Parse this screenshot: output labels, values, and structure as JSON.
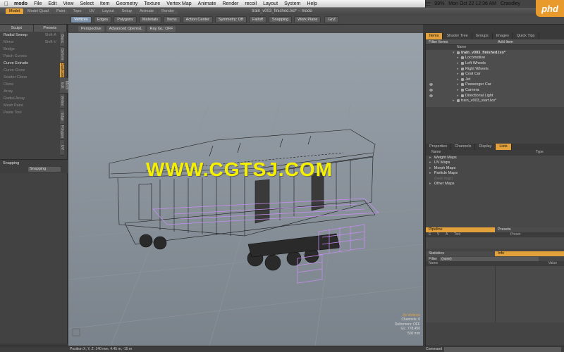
{
  "macmenu": {
    "apple": "",
    "items": [
      "modo",
      "File",
      "Edit",
      "View",
      "Select",
      "Item",
      "Geometry",
      "Texture",
      "Vertex Map",
      "Animate",
      "Render",
      "recoil",
      "Layout",
      "System",
      "Help"
    ],
    "battery": "99%",
    "clock": "Mon Oct 22  12:36 AM",
    "user": "Crandley"
  },
  "logo": "phd",
  "window": {
    "title": "train_v003_finished.lxo* – modo",
    "tabs": [
      "Model",
      "Model Quad",
      "Paint",
      "Topo",
      "UV",
      "Layout",
      "Setup",
      "Animate",
      "Render"
    ],
    "active_tab": "Model"
  },
  "toolbar": {
    "modes": [
      "Vertices",
      "Edges",
      "Polygons",
      "Materials",
      "Items"
    ],
    "active_mode": "Vertices",
    "action_center": "Action Center",
    "symmetry": "Symmetry: Off",
    "falloff": "Falloff",
    "snapping": "Snapping",
    "work_plane": "Work Plane",
    "gnz": "GnZ"
  },
  "left": {
    "header": [
      "Sculpt",
      "Presets"
    ],
    "tools": [
      {
        "label": "Radial Sweep",
        "shortcut": "Shift-A",
        "dim": false
      },
      {
        "label": "Mirror",
        "shortcut": "Shift-V",
        "dim": true
      },
      {
        "label": "Bridge",
        "shortcut": "",
        "dim": true
      },
      {
        "label": "Patch Curves",
        "shortcut": "",
        "dim": true
      },
      {
        "label": "Curve Extrude",
        "shortcut": "",
        "dim": false
      },
      {
        "label": "Curve Clone",
        "shortcut": "",
        "dim": true
      },
      {
        "label": "Scatter Clone",
        "shortcut": "",
        "dim": true
      },
      {
        "label": "Clone",
        "shortcut": "",
        "dim": true
      },
      {
        "label": "Array",
        "shortcut": "",
        "dim": true
      },
      {
        "label": "Radial Array",
        "shortcut": "",
        "dim": true
      },
      {
        "label": "Mesh Paint",
        "shortcut": "",
        "dim": true
      },
      {
        "label": "Paste Tool",
        "shortcut": "",
        "dim": true
      }
    ],
    "vtabs": [
      "Basic",
      "Deform",
      "Duplicate",
      "Mesh Edit",
      "Vertex",
      "Edge",
      "Polygon",
      "UV"
    ],
    "active_vtab": "Duplicate",
    "snapping_header": "Snapping",
    "snapping_label": "Snapping"
  },
  "viewport": {
    "header": [
      "Perspective",
      "Advanced OpenGL",
      "Ray GL: OFF"
    ],
    "watermark": "WWW.CGTSJ.COM",
    "stats": [
      "2p Vertices",
      "Channels: 0",
      "Deformers: OFF",
      "GL: 778,450",
      "500 mm"
    ]
  },
  "status": {
    "position": "Position X, Y, Z:   140 mm, 4.45 m, -15 m",
    "command": "Command"
  },
  "items_panel": {
    "tabs": [
      "Items",
      "Shader Tree",
      "Groups",
      "Images",
      "Quick Tips"
    ],
    "active_tab": "Items",
    "filter": "Filter Items",
    "add": "Add Item",
    "column": "Name",
    "tree": [
      {
        "label": "train_v003_finished.lxo*",
        "depth": 0,
        "eye": false,
        "expanded": true
      },
      {
        "label": "Locomotive",
        "depth": 1,
        "eye": false
      },
      {
        "label": "Left Wheels",
        "depth": 1,
        "eye": false
      },
      {
        "label": "Right Wheels",
        "depth": 1,
        "eye": false
      },
      {
        "label": "Coal Car",
        "depth": 1,
        "eye": false
      },
      {
        "label": "Jet",
        "depth": 1,
        "eye": false
      },
      {
        "label": "Passenger Car",
        "depth": 1,
        "eye": true
      },
      {
        "label": "Camera",
        "depth": 1,
        "eye": true
      },
      {
        "label": "Directional Light",
        "depth": 1,
        "eye": true
      },
      {
        "label": "train_v003_start.lxo*",
        "depth": 0,
        "eye": false
      }
    ]
  },
  "lists_panel": {
    "tabs": [
      "Properties",
      "Channels",
      "Display",
      "Lists"
    ],
    "active_tab": "Lists",
    "col_name": "Name",
    "col_type": "Type",
    "items": [
      {
        "label": "Weight Maps",
        "dim": false,
        "arrow": true
      },
      {
        "label": "UV Maps",
        "dim": false,
        "arrow": true
      },
      {
        "label": "Morph Maps",
        "dim": false,
        "arrow": true
      },
      {
        "label": "Particle Maps",
        "dim": false,
        "arrow": true
      },
      {
        "label": "(new map)",
        "dim": true,
        "arrow": false
      },
      {
        "label": "Other Maps",
        "dim": false,
        "arrow": true
      }
    ]
  },
  "pipeline": {
    "tabs": [
      "Pipeline",
      "Presets"
    ],
    "cols": [
      "E",
      "V",
      "A",
      "Tool",
      "Preset"
    ]
  },
  "stats_panel": {
    "tabs": [
      "Statistics",
      "Info"
    ],
    "filter_label": "Filter",
    "filter_value": "(none)",
    "col_name": "Name",
    "col_value": "Value"
  }
}
